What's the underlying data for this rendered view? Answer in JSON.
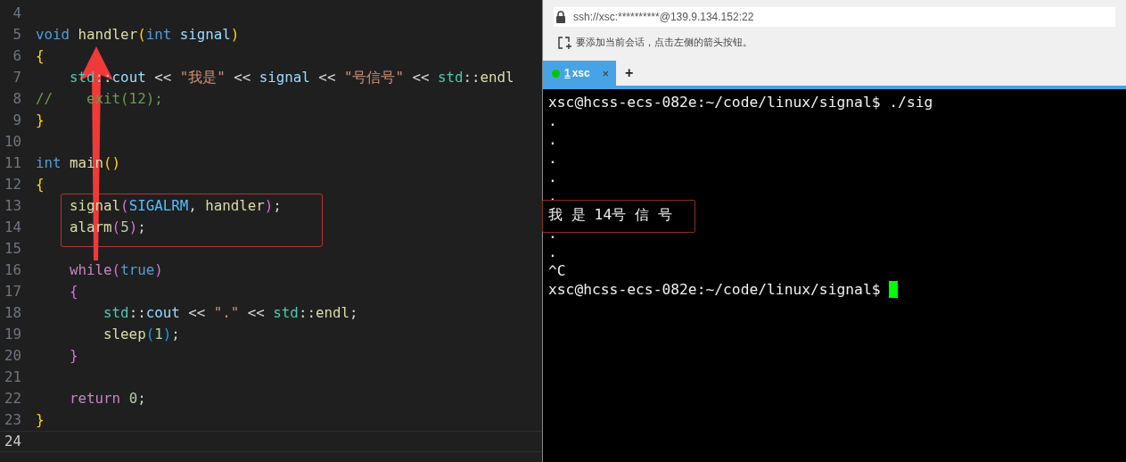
{
  "editor": {
    "lines": [
      {
        "number": "4",
        "active": false
      },
      {
        "number": "5",
        "active": false,
        "tokens": [
          {
            "kind": "kw",
            "text": "void "
          },
          {
            "kind": "fn",
            "text": "handler"
          },
          {
            "kind": "brace1",
            "text": "("
          },
          {
            "kind": "kw",
            "text": "int "
          },
          {
            "kind": "var",
            "text": "signal"
          },
          {
            "kind": "brace1",
            "text": ")"
          }
        ]
      },
      {
        "number": "6",
        "active": false,
        "tokens": [
          {
            "kind": "brace1",
            "text": "{"
          }
        ]
      },
      {
        "number": "7",
        "active": false,
        "tokens": [
          {
            "kind": "ns",
            "text": "    std"
          },
          {
            "kind": "plain",
            "text": "::"
          },
          {
            "kind": "var",
            "text": "cout"
          },
          {
            "kind": "plain",
            "text": " << "
          },
          {
            "kind": "str",
            "text": "\"我是\""
          },
          {
            "kind": "plain",
            "text": " << "
          },
          {
            "kind": "var",
            "text": "signal"
          },
          {
            "kind": "plain",
            "text": " << "
          },
          {
            "kind": "str",
            "text": "\"号信号\""
          },
          {
            "kind": "plain",
            "text": " << "
          },
          {
            "kind": "ns",
            "text": "std"
          },
          {
            "kind": "plain",
            "text": "::"
          },
          {
            "kind": "fn",
            "text": "endl"
          }
        ]
      },
      {
        "number": "8",
        "active": false,
        "tokens": [
          {
            "kind": "cmt",
            "text": "//    exit(12);"
          }
        ]
      },
      {
        "number": "9",
        "active": false,
        "tokens": [
          {
            "kind": "brace1",
            "text": "}"
          }
        ]
      },
      {
        "number": "10",
        "active": false
      },
      {
        "number": "11",
        "active": false,
        "tokens": [
          {
            "kind": "kw",
            "text": "int "
          },
          {
            "kind": "fn",
            "text": "main"
          },
          {
            "kind": "brace1",
            "text": "()"
          }
        ]
      },
      {
        "number": "12",
        "active": false,
        "tokens": [
          {
            "kind": "brace1",
            "text": "{"
          }
        ]
      },
      {
        "number": "13",
        "active": false,
        "tokens": [
          {
            "kind": "fn",
            "text": "    signal"
          },
          {
            "kind": "brace2",
            "text": "("
          },
          {
            "kind": "const",
            "text": "SIGALRM"
          },
          {
            "kind": "plain",
            "text": ", "
          },
          {
            "kind": "fn",
            "text": "handler"
          },
          {
            "kind": "brace2",
            "text": ")"
          },
          {
            "kind": "plain",
            "text": ";"
          }
        ]
      },
      {
        "number": "14",
        "active": false,
        "tokens": [
          {
            "kind": "fn",
            "text": "    alarm"
          },
          {
            "kind": "brace2",
            "text": "("
          },
          {
            "kind": "num",
            "text": "5"
          },
          {
            "kind": "brace2",
            "text": ")"
          },
          {
            "kind": "plain",
            "text": ";"
          }
        ]
      },
      {
        "number": "15",
        "active": false
      },
      {
        "number": "16",
        "active": false,
        "tokens": [
          {
            "kind": "ctl",
            "text": "    while"
          },
          {
            "kind": "brace2",
            "text": "("
          },
          {
            "kind": "kw",
            "text": "true"
          },
          {
            "kind": "brace2",
            "text": ")"
          }
        ]
      },
      {
        "number": "17",
        "active": false,
        "tokens": [
          {
            "kind": "brace2",
            "text": "    {"
          }
        ]
      },
      {
        "number": "18",
        "active": false,
        "tokens": [
          {
            "kind": "ns",
            "text": "        std"
          },
          {
            "kind": "plain",
            "text": "::"
          },
          {
            "kind": "var",
            "text": "cout"
          },
          {
            "kind": "plain",
            "text": " << "
          },
          {
            "kind": "str",
            "text": "\".\""
          },
          {
            "kind": "plain",
            "text": " << "
          },
          {
            "kind": "ns",
            "text": "std"
          },
          {
            "kind": "plain",
            "text": "::"
          },
          {
            "kind": "fn",
            "text": "endl"
          },
          {
            "kind": "plain",
            "text": ";"
          }
        ]
      },
      {
        "number": "19",
        "active": false,
        "tokens": [
          {
            "kind": "fn",
            "text": "        sleep"
          },
          {
            "kind": "brace3",
            "text": "("
          },
          {
            "kind": "num",
            "text": "1"
          },
          {
            "kind": "brace3",
            "text": ")"
          },
          {
            "kind": "plain",
            "text": ";"
          }
        ]
      },
      {
        "number": "20",
        "active": false,
        "tokens": [
          {
            "kind": "brace2",
            "text": "    }"
          }
        ]
      },
      {
        "number": "21",
        "active": false
      },
      {
        "number": "22",
        "active": false,
        "tokens": [
          {
            "kind": "ctl",
            "text": "    return "
          },
          {
            "kind": "num",
            "text": "0"
          },
          {
            "kind": "plain",
            "text": ";"
          }
        ]
      },
      {
        "number": "23",
        "active": false,
        "tokens": [
          {
            "kind": "brace1",
            "text": "}"
          }
        ]
      },
      {
        "number": "24",
        "active": true
      }
    ]
  },
  "terminal_app": {
    "address": "ssh://xsc:**********@139.9.134.152:22",
    "hint": "要添加当前会话，点击左侧的箭头按钮。",
    "tabs": [
      {
        "number": "1",
        "label": "xsc",
        "selected": true,
        "color": "#00c800",
        "close": "×"
      }
    ],
    "add_tab": "+",
    "output": [
      {
        "kind": "text",
        "text": "xsc@hcss-ecs-082e:~/code/linux/signal$ ./sig"
      },
      {
        "kind": "text",
        "text": "."
      },
      {
        "kind": "text",
        "text": "."
      },
      {
        "kind": "text",
        "text": "."
      },
      {
        "kind": "text",
        "text": "."
      },
      {
        "kind": "text",
        "text": "."
      },
      {
        "kind": "text",
        "text": "我 是 14号 信 号"
      },
      {
        "kind": "text",
        "text": "."
      },
      {
        "kind": "text",
        "text": "."
      },
      {
        "kind": "text",
        "text": "^C"
      },
      {
        "kind": "prompt",
        "text": "xsc@hcss-ecs-082e:~/code/linux/signal$"
      }
    ]
  }
}
